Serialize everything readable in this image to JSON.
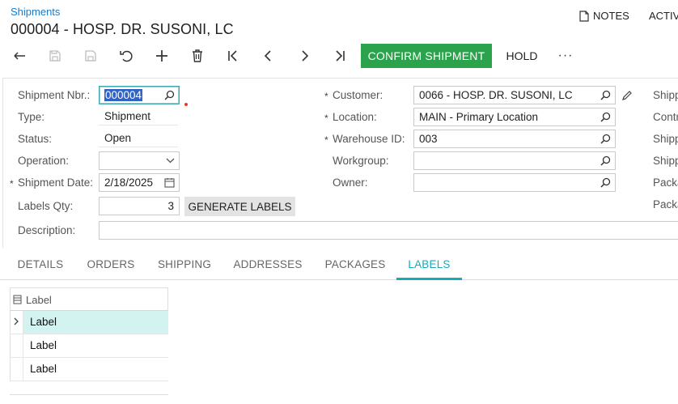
{
  "header": {
    "breadcrumb": "Shipments",
    "title": "000004 - HOSP. DR. SUSONI, LC",
    "notes_label": "NOTES",
    "activities_label": "ACTIV"
  },
  "toolbar": {
    "confirm_label": "CONFIRM SHIPMENT",
    "hold_label": "HOLD",
    "more_label": "···"
  },
  "form": {
    "shipment_nbr_label": "Shipment Nbr.:",
    "shipment_nbr_value": "000004",
    "type_label": "Type:",
    "type_value": "Shipment",
    "status_label": "Status:",
    "status_value": "Open",
    "operation_label": "Operation:",
    "operation_value": "",
    "shipment_date_label": "Shipment Date:",
    "shipment_date_value": "2/18/2025",
    "labels_qty_label": "Labels Qty:",
    "labels_qty_value": "3",
    "generate_labels_label": "GENERATE LABELS",
    "description_label": "Description:",
    "description_value": "",
    "customer_label": "Customer:",
    "customer_value": "0066 - HOSP. DR. SUSONI, LC",
    "location_label": "Location:",
    "location_value": "MAIN - Primary Location",
    "warehouse_label": "Warehouse ID:",
    "warehouse_value": "003",
    "workgroup_label": "Workgroup:",
    "workgroup_value": "",
    "owner_label": "Owner:",
    "owner_value": "",
    "required_mark": "*",
    "right_col_labels": [
      "Shipp",
      "Contr",
      "Shipp",
      "Shipp",
      "Packa",
      "Packa"
    ]
  },
  "tabs": [
    {
      "label": "DETAILS"
    },
    {
      "label": "ORDERS"
    },
    {
      "label": "SHIPPING"
    },
    {
      "label": "ADDRESSES"
    },
    {
      "label": "PACKAGES"
    },
    {
      "label": "LABELS",
      "active": true
    }
  ],
  "grid": {
    "header": "Label",
    "rows": [
      "Label",
      "Label",
      "Label"
    ]
  },
  "colors": {
    "accent": "#1aa9b8",
    "confirm": "#2ba24c",
    "link": "#1a7ac4",
    "selected_row": "#d3f3f1"
  },
  "icons": [
    "undo-icon",
    "save-icon",
    "save-close-icon",
    "cancel-icon",
    "add-icon",
    "delete-icon",
    "first-icon",
    "prev-icon",
    "next-icon",
    "last-icon",
    "search-icon",
    "calendar-icon",
    "chevron-down-icon",
    "edit-icon",
    "notes-icon",
    "expand-row-icon"
  ]
}
